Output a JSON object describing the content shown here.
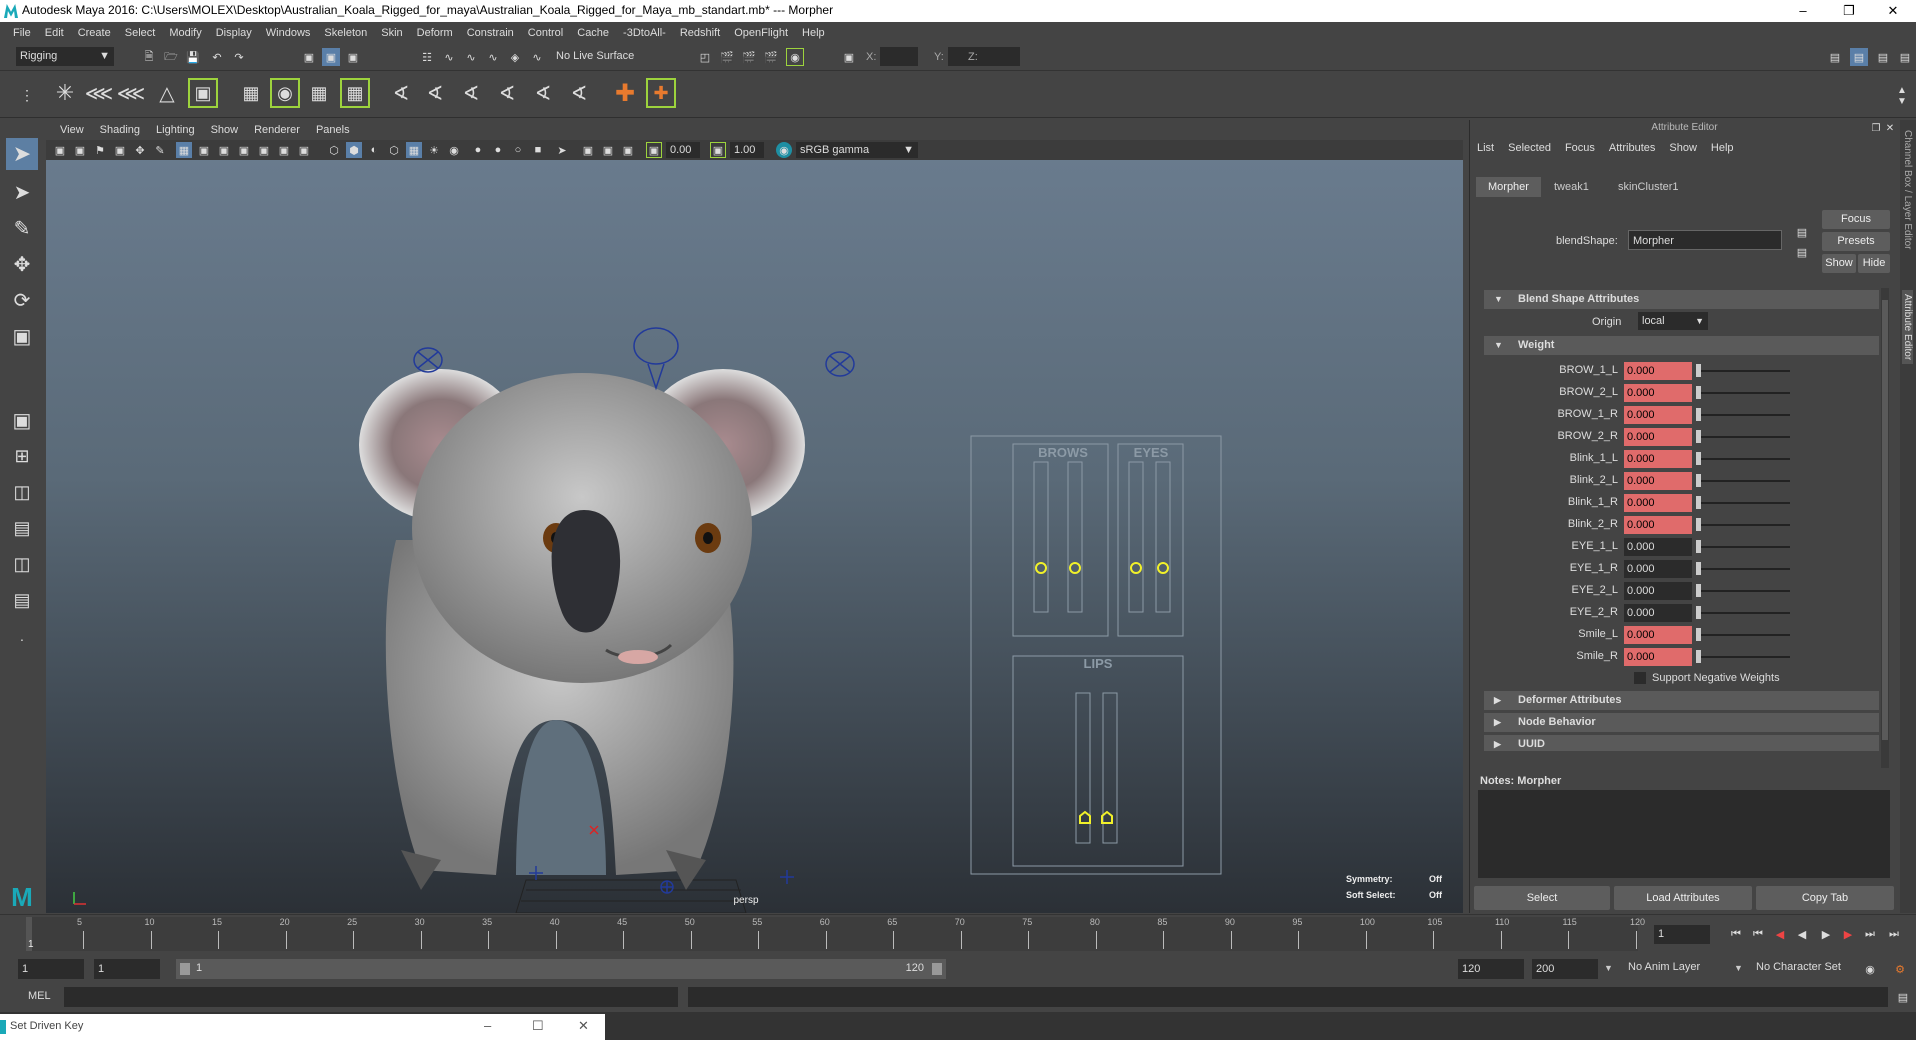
{
  "title": "Autodesk Maya 2016: C:\\Users\\MOLEX\\Desktop\\Australian_Koala_Rigged_for_maya\\Australian_Koala_Rigged_for_Maya_mb_standart.mb*  ---  Morpher",
  "menus": [
    "File",
    "Edit",
    "Create",
    "Select",
    "Modify",
    "Display",
    "Windows",
    "Skeleton",
    "Skin",
    "Deform",
    "Constrain",
    "Control",
    "Cache",
    "-3DtoAll-",
    "Redshift",
    "OpenFlight",
    "Help"
  ],
  "status": {
    "menuset": "Rigging",
    "live_surface": "No Live Surface",
    "x_label": "X:",
    "y_label": "Y:",
    "z_label": "Z:"
  },
  "viewport": {
    "menus": [
      "View",
      "Shading",
      "Lighting",
      "Show",
      "Renderer",
      "Panels"
    ],
    "near": "0.00",
    "far": "1.00",
    "color_mgmt": "sRGB gamma",
    "camera": "persp",
    "symmetry_label": "Symmetry:",
    "symmetry_value": "Off",
    "soft_label": "Soft Select:",
    "soft_value": "Off",
    "brows": "BROWS",
    "eyes": "EYES",
    "lips": "LIPS"
  },
  "ae": {
    "header": "Attribute Editor",
    "menu": [
      "List",
      "Selected",
      "Focus",
      "Attributes",
      "Show",
      "Help"
    ],
    "tabs": [
      "Morpher",
      "tweak1",
      "skinCluster1"
    ],
    "blend_label": "blendShape:",
    "blend_value": "Morpher",
    "focus": "Focus",
    "presets": "Presets",
    "show": "Show",
    "hide": "Hide",
    "sec_blend": "Blend Shape Attributes",
    "origin_label": "Origin",
    "origin_value": "local",
    "sec_weight": "Weight",
    "weights": [
      {
        "n": "BROW_1_L",
        "v": "0.000",
        "k": true
      },
      {
        "n": "BROW_2_L",
        "v": "0.000",
        "k": true
      },
      {
        "n": "BROW_1_R",
        "v": "0.000",
        "k": true
      },
      {
        "n": "BROW_2_R",
        "v": "0.000",
        "k": true
      },
      {
        "n": "Blink_1_L",
        "v": "0.000",
        "k": true
      },
      {
        "n": "Blink_2_L",
        "v": "0.000",
        "k": true
      },
      {
        "n": "Blink_1_R",
        "v": "0.000",
        "k": true
      },
      {
        "n": "Blink_2_R",
        "v": "0.000",
        "k": true
      },
      {
        "n": "EYE_1_L",
        "v": "0.000",
        "k": false
      },
      {
        "n": "EYE_1_R",
        "v": "0.000",
        "k": false
      },
      {
        "n": "EYE_2_L",
        "v": "0.000",
        "k": false
      },
      {
        "n": "EYE_2_R",
        "v": "0.000",
        "k": false
      },
      {
        "n": "Smile_L",
        "v": "0.000",
        "k": true
      },
      {
        "n": "Smile_R",
        "v": "0.000",
        "k": true
      }
    ],
    "neg_weights": "Support Negative Weights",
    "sec_deformer": "Deformer Attributes",
    "sec_node": "Node Behavior",
    "sec_uuid": "UUID",
    "notes": "Notes:  Morpher",
    "btn_select": "Select",
    "btn_load": "Load Attributes",
    "btn_copy": "Copy Tab",
    "side_tabs": "Channel Box / Layer Editor",
    "side_tabs2": "Attribute Editor"
  },
  "timeline": {
    "ticks": [
      "5",
      "10",
      "15",
      "20",
      "25",
      "30",
      "35",
      "40",
      "45",
      "50",
      "55",
      "60",
      "65",
      "70",
      "75",
      "80",
      "85",
      "90",
      "95",
      "100",
      "105",
      "110",
      "115",
      "120"
    ],
    "first": "1",
    "current": "1"
  },
  "range": {
    "start": "1",
    "pstart": "1",
    "slider_start": "1",
    "slider_end": "120",
    "pend": "120",
    "end": "200",
    "anim_layer": "No Anim Layer",
    "char_set": "No Character Set"
  },
  "cmd": {
    "label": "MEL"
  },
  "taskbar": {
    "window": "Set Driven Key"
  }
}
